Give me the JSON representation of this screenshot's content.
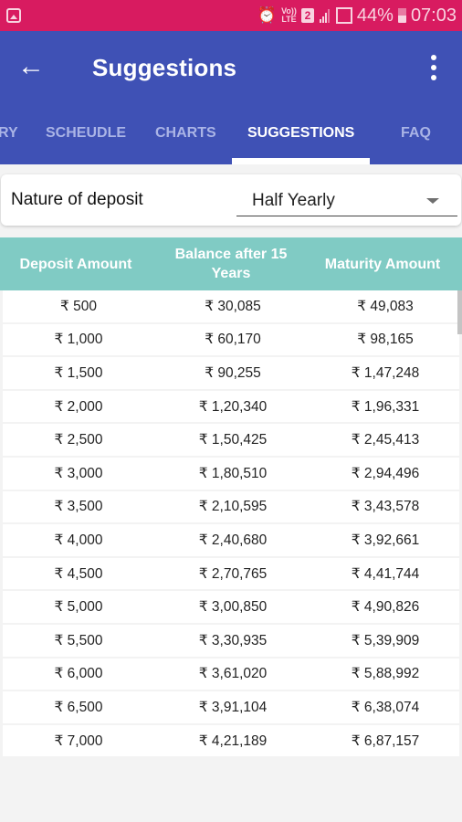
{
  "status_bar": {
    "battery_percent": "44%",
    "time": "07:03",
    "network": "LTE",
    "volte": "Vo))",
    "sim_slot": "2",
    "icons": [
      "gallery-icon",
      "alarm-icon",
      "volte-icon",
      "sim-icon",
      "signal-icon",
      "signal-icon",
      "battery-icon"
    ]
  },
  "app_bar": {
    "title": "Suggestions",
    "back_icon": "arrow-left-icon",
    "menu_icon": "more-vert-icon",
    "color": "#3f51b5"
  },
  "tabs": [
    {
      "label": "SUMMARY",
      "visible_label": "RY",
      "active": false
    },
    {
      "label": "SCHEUDLE",
      "active": false
    },
    {
      "label": "CHARTS",
      "active": false
    },
    {
      "label": "SUGGESTIONS",
      "active": true
    },
    {
      "label": "FAQ",
      "active": false
    }
  ],
  "form": {
    "label": "Nature of deposit",
    "selected": "Half Yearly"
  },
  "table": {
    "header_color": "#80cbc4",
    "columns": [
      "Deposit Amount",
      "Balance after 15 Years",
      "Maturity Amount"
    ],
    "rows": [
      [
        "₹ 500",
        "₹ 30,085",
        "₹ 49,083"
      ],
      [
        "₹ 1,000",
        "₹ 60,170",
        "₹ 98,165"
      ],
      [
        "₹ 1,500",
        "₹ 90,255",
        "₹ 1,47,248"
      ],
      [
        "₹ 2,000",
        "₹ 1,20,340",
        "₹ 1,96,331"
      ],
      [
        "₹ 2,500",
        "₹ 1,50,425",
        "₹ 2,45,413"
      ],
      [
        "₹ 3,000",
        "₹ 1,80,510",
        "₹ 2,94,496"
      ],
      [
        "₹ 3,500",
        "₹ 2,10,595",
        "₹ 3,43,578"
      ],
      [
        "₹ 4,000",
        "₹ 2,40,680",
        "₹ 3,92,661"
      ],
      [
        "₹ 4,500",
        "₹ 2,70,765",
        "₹ 4,41,744"
      ],
      [
        "₹ 5,000",
        "₹ 3,00,850",
        "₹ 4,90,826"
      ],
      [
        "₹ 5,500",
        "₹ 3,30,935",
        "₹ 5,39,909"
      ],
      [
        "₹ 6,000",
        "₹ 3,61,020",
        "₹ 5,88,992"
      ],
      [
        "₹ 6,500",
        "₹ 3,91,104",
        "₹ 6,38,074"
      ],
      [
        "₹ 7,000",
        "₹ 4,21,189",
        "₹ 6,87,157"
      ]
    ]
  }
}
